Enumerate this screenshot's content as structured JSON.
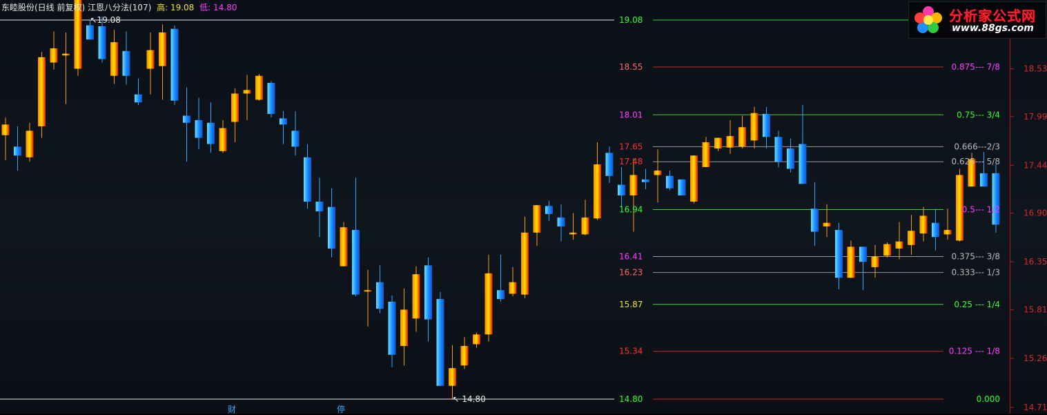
{
  "header": {
    "title": "东睦股份(日线 前复权) 江恩八分法(107)",
    "high_label": "高: 19.08",
    "low_label": "低: 14.80"
  },
  "logo": {
    "name": "分析家公式网",
    "url": "www.88gs.com"
  },
  "footer_markers": [
    "财",
    "停"
  ],
  "chart_data": {
    "type": "candlestick",
    "price_range": [
      14.71,
      19.08
    ],
    "right_axis_ticks": [
      "18.53",
      "17.99",
      "17.44",
      "16.90",
      "16.35",
      "15.81",
      "15.26",
      "14.71"
    ],
    "extreme_labels": {
      "high": "19.08",
      "low": "14.80"
    },
    "levels": [
      {
        "price": 19.08,
        "price_label": "19.08",
        "price_color": "#33ff33",
        "line_color": "#3fd13f",
        "right_label": "",
        "right_color": "#ff3cff"
      },
      {
        "price": 18.55,
        "price_label": "18.55",
        "price_color": "#ff6a6a",
        "line_color": "#cc2222",
        "right_label": "0.875--- 7/8",
        "right_color": "#ff3cff"
      },
      {
        "price": 18.01,
        "price_label": "18.01",
        "price_color": "#ff3cff",
        "line_color": "#3fd13f",
        "right_label": "0.75--- 3/4",
        "right_color": "#33ff33"
      },
      {
        "price": 17.65,
        "price_label": "17.65",
        "price_color": "#ff3030",
        "line_color": "#9a9a9a",
        "right_label": "0.666---2/3",
        "right_color": "#b8b8b8"
      },
      {
        "price": 17.48,
        "price_label": "17.48",
        "price_color": "#ff3030",
        "line_color": "#9a9a9a",
        "right_label": "0.625--- 5/8",
        "right_color": "#b8b8b8"
      },
      {
        "price": 16.94,
        "price_label": "16.94",
        "price_color": "#33ff33",
        "line_color": "#3fd13f",
        "right_label": "0.5--- 1/2",
        "right_color": "#ff3cff"
      },
      {
        "price": 16.41,
        "price_label": "16.41",
        "price_color": "#ff3cff",
        "line_color": "#9a9a9a",
        "right_label": "0.375--- 3/8",
        "right_color": "#b8b8b8"
      },
      {
        "price": 16.23,
        "price_label": "16.23",
        "price_color": "#ff6a6a",
        "line_color": "#9a9a9a",
        "right_label": "0.333--- 1/3",
        "right_color": "#b8b8b8"
      },
      {
        "price": 15.87,
        "price_label": "15.87",
        "price_color": "#f2e436",
        "line_color": "#3fd13f",
        "right_label": "0.25 --- 1/4",
        "right_color": "#33ff33"
      },
      {
        "price": 15.34,
        "price_label": "15.34",
        "price_color": "#ff3030",
        "line_color": "#cc2222",
        "right_label": "0.125 --- 1/8",
        "right_color": "#ff3cff"
      },
      {
        "price": 14.8,
        "price_label": "14.80",
        "price_color": "#33ff33",
        "line_color": "#cc2222",
        "right_label": "0.000",
        "right_color": "#33ff33"
      }
    ],
    "candles": [
      {
        "o": 17.78,
        "h": 17.98,
        "l": 17.5,
        "c": 17.9
      },
      {
        "o": 17.65,
        "h": 17.88,
        "l": 17.38,
        "c": 17.55
      },
      {
        "o": 17.53,
        "h": 17.92,
        "l": 17.48,
        "c": 17.83
      },
      {
        "o": 17.88,
        "h": 18.72,
        "l": 17.75,
        "c": 18.66
      },
      {
        "o": 18.6,
        "h": 18.95,
        "l": 18.52,
        "c": 18.76
      },
      {
        "o": 18.68,
        "h": 18.94,
        "l": 18.13,
        "c": 18.7
      },
      {
        "o": 18.53,
        "h": 19.08,
        "l": 18.45,
        "c": 19.32
      },
      {
        "o": 19.02,
        "h": 19.08,
        "l": 18.88,
        "c": 18.86
      },
      {
        "o": 19.01,
        "h": 19.12,
        "l": 18.6,
        "c": 18.64
      },
      {
        "o": 18.45,
        "h": 18.97,
        "l": 18.36,
        "c": 18.83
      },
      {
        "o": 18.73,
        "h": 18.95,
        "l": 18.35,
        "c": 18.45
      },
      {
        "o": 18.24,
        "h": 18.42,
        "l": 18.12,
        "c": 18.15
      },
      {
        "o": 18.53,
        "h": 18.94,
        "l": 18.24,
        "c": 18.74
      },
      {
        "o": 18.56,
        "h": 19.03,
        "l": 18.18,
        "c": 18.94
      },
      {
        "o": 18.98,
        "h": 19.02,
        "l": 18.12,
        "c": 18.17
      },
      {
        "o": 18.0,
        "h": 18.32,
        "l": 17.48,
        "c": 17.92
      },
      {
        "o": 17.95,
        "h": 18.2,
        "l": 17.62,
        "c": 17.75
      },
      {
        "o": 17.92,
        "h": 18.15,
        "l": 17.58,
        "c": 17.68
      },
      {
        "o": 17.6,
        "h": 17.95,
        "l": 17.58,
        "c": 17.86
      },
      {
        "o": 17.93,
        "h": 18.31,
        "l": 17.7,
        "c": 18.25
      },
      {
        "o": 18.25,
        "h": 18.46,
        "l": 17.95,
        "c": 18.29
      },
      {
        "o": 18.18,
        "h": 18.47,
        "l": 18.17,
        "c": 18.45
      },
      {
        "o": 18.37,
        "h": 18.39,
        "l": 17.98,
        "c": 18.02
      },
      {
        "o": 17.97,
        "h": 18.05,
        "l": 17.68,
        "c": 17.9
      },
      {
        "o": 17.83,
        "h": 18.05,
        "l": 17.55,
        "c": 17.65
      },
      {
        "o": 17.53,
        "h": 17.68,
        "l": 16.95,
        "c": 17.03
      },
      {
        "o": 17.03,
        "h": 17.3,
        "l": 16.63,
        "c": 16.92
      },
      {
        "o": 16.97,
        "h": 17.18,
        "l": 16.4,
        "c": 16.5
      },
      {
        "o": 16.3,
        "h": 16.8,
        "l": 16.48,
        "c": 16.74
      },
      {
        "o": 16.71,
        "h": 17.3,
        "l": 15.96,
        "c": 15.98
      },
      {
        "o": 16.02,
        "h": 16.26,
        "l": 15.62,
        "c": 16.03
      },
      {
        "o": 16.12,
        "h": 16.31,
        "l": 15.77,
        "c": 15.82
      },
      {
        "o": 15.9,
        "h": 15.97,
        "l": 15.16,
        "c": 15.3
      },
      {
        "o": 15.4,
        "h": 16.05,
        "l": 15.18,
        "c": 15.81
      },
      {
        "o": 15.71,
        "h": 16.3,
        "l": 15.56,
        "c": 16.21
      },
      {
        "o": 16.31,
        "h": 16.4,
        "l": 15.45,
        "c": 15.7
      },
      {
        "o": 15.93,
        "h": 16.01,
        "l": 15.03,
        "c": 14.95
      },
      {
        "o": 14.95,
        "h": 15.41,
        "l": 14.8,
        "c": 15.15
      },
      {
        "o": 15.18,
        "h": 15.5,
        "l": 15.14,
        "c": 15.4
      },
      {
        "o": 15.42,
        "h": 15.55,
        "l": 15.38,
        "c": 15.53
      },
      {
        "o": 15.53,
        "h": 16.43,
        "l": 15.45,
        "c": 16.22
      },
      {
        "o": 16.03,
        "h": 16.43,
        "l": 15.9,
        "c": 15.93
      },
      {
        "o": 15.99,
        "h": 16.29,
        "l": 15.96,
        "c": 16.12
      },
      {
        "o": 15.98,
        "h": 16.86,
        "l": 15.94,
        "c": 16.68
      },
      {
        "o": 16.68,
        "h": 16.98,
        "l": 16.53,
        "c": 16.99
      },
      {
        "o": 16.98,
        "h": 17.04,
        "l": 16.81,
        "c": 16.89
      },
      {
        "o": 16.85,
        "h": 17.0,
        "l": 16.58,
        "c": 16.75
      },
      {
        "o": 16.66,
        "h": 16.9,
        "l": 16.6,
        "c": 16.68
      },
      {
        "o": 16.66,
        "h": 17.05,
        "l": 16.65,
        "c": 16.85
      },
      {
        "o": 16.84,
        "h": 17.7,
        "l": 16.82,
        "c": 17.45
      },
      {
        "o": 17.58,
        "h": 17.65,
        "l": 17.24,
        "c": 17.32
      },
      {
        "o": 17.22,
        "h": 17.42,
        "l": 16.97,
        "c": 17.1
      },
      {
        "o": 17.1,
        "h": 17.52,
        "l": 16.69,
        "c": 17.33
      },
      {
        "o": 17.28,
        "h": 17.4,
        "l": 17.17,
        "c": 17.25
      },
      {
        "o": 17.33,
        "h": 17.62,
        "l": 17.02,
        "c": 17.38
      },
      {
        "o": 17.32,
        "h": 17.38,
        "l": 17.16,
        "c": 17.18
      },
      {
        "o": 17.28,
        "h": 17.21,
        "l": 17.19,
        "c": 17.1
      },
      {
        "o": 17.03,
        "h": 17.3,
        "l": 17.01,
        "c": 17.55
      },
      {
        "o": 17.42,
        "h": 17.76,
        "l": 17.44,
        "c": 17.7
      },
      {
        "o": 17.63,
        "h": 17.73,
        "l": 17.6,
        "c": 17.75
      },
      {
        "o": 17.64,
        "h": 17.95,
        "l": 17.57,
        "c": 17.77
      },
      {
        "o": 17.65,
        "h": 18.0,
        "l": 17.63,
        "c": 17.87
      },
      {
        "o": 17.72,
        "h": 18.1,
        "l": 17.63,
        "c": 18.03
      },
      {
        "o": 18.02,
        "h": 18.1,
        "l": 17.63,
        "c": 17.76
      },
      {
        "o": 17.76,
        "h": 17.83,
        "l": 17.42,
        "c": 17.48
      },
      {
        "o": 17.63,
        "h": 17.74,
        "l": 17.36,
        "c": 17.4
      },
      {
        "o": 17.68,
        "h": 18.12,
        "l": 17.23,
        "c": 17.23
      },
      {
        "o": 16.95,
        "h": 17.25,
        "l": 16.53,
        "c": 16.69
      },
      {
        "o": 16.75,
        "h": 17.0,
        "l": 16.63,
        "c": 16.79
      },
      {
        "o": 16.71,
        "h": 16.79,
        "l": 16.04,
        "c": 16.17
      },
      {
        "o": 16.17,
        "h": 16.59,
        "l": 16.2,
        "c": 16.52
      },
      {
        "o": 16.52,
        "h": 16.48,
        "l": 16.03,
        "c": 16.35
      },
      {
        "o": 16.29,
        "h": 16.54,
        "l": 16.17,
        "c": 16.41
      },
      {
        "o": 16.42,
        "h": 16.57,
        "l": 16.4,
        "c": 16.55
      },
      {
        "o": 16.5,
        "h": 16.8,
        "l": 16.38,
        "c": 16.58
      },
      {
        "o": 16.54,
        "h": 16.88,
        "l": 16.43,
        "c": 16.7
      },
      {
        "o": 16.67,
        "h": 16.97,
        "l": 16.58,
        "c": 16.87
      },
      {
        "o": 16.79,
        "h": 16.95,
        "l": 16.48,
        "c": 16.63
      },
      {
        "o": 16.66,
        "h": 16.95,
        "l": 16.6,
        "c": 16.71
      },
      {
        "o": 16.59,
        "h": 17.4,
        "l": 16.58,
        "c": 17.33
      },
      {
        "o": 17.2,
        "h": 17.58,
        "l": 17.22,
        "c": 17.51
      },
      {
        "o": 17.35,
        "h": 17.59,
        "l": 17.24,
        "c": 17.2
      },
      {
        "o": 17.35,
        "h": 17.45,
        "l": 16.68,
        "c": 16.77
      }
    ]
  }
}
